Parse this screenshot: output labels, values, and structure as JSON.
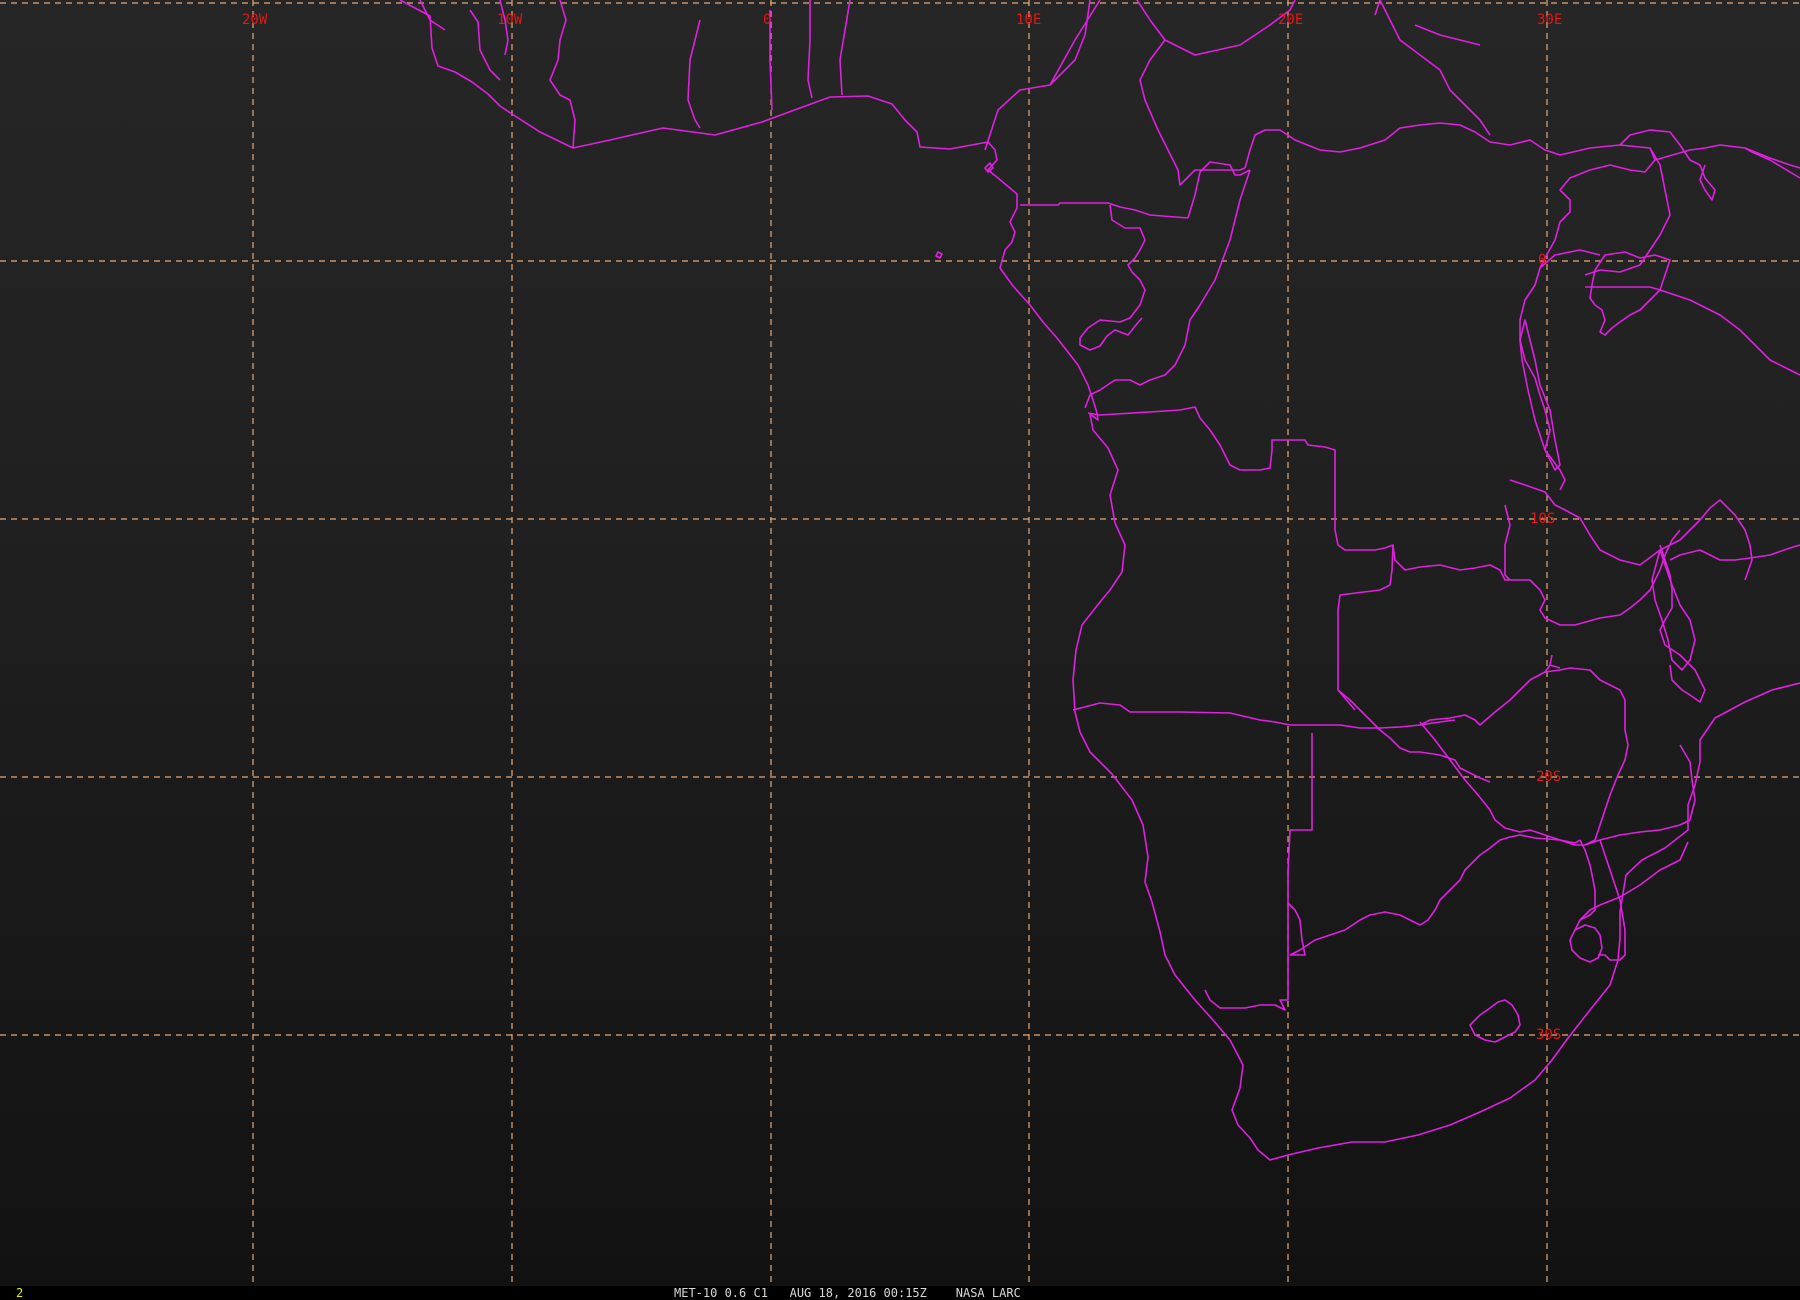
{
  "map": {
    "frame_number": "2",
    "caption": "MET-10 0.6 C1   AUG 18, 2016 00:15Z    NASA LARC",
    "grid_color": "#e7a877",
    "border_color": "#e020e0",
    "label_color": "#e01818",
    "longitude_labels": [
      "20W",
      "10W",
      "0",
      "10E",
      "20E",
      "30E"
    ],
    "latitude_labels": [
      "0",
      "10S",
      "20S",
      "30S"
    ]
  }
}
